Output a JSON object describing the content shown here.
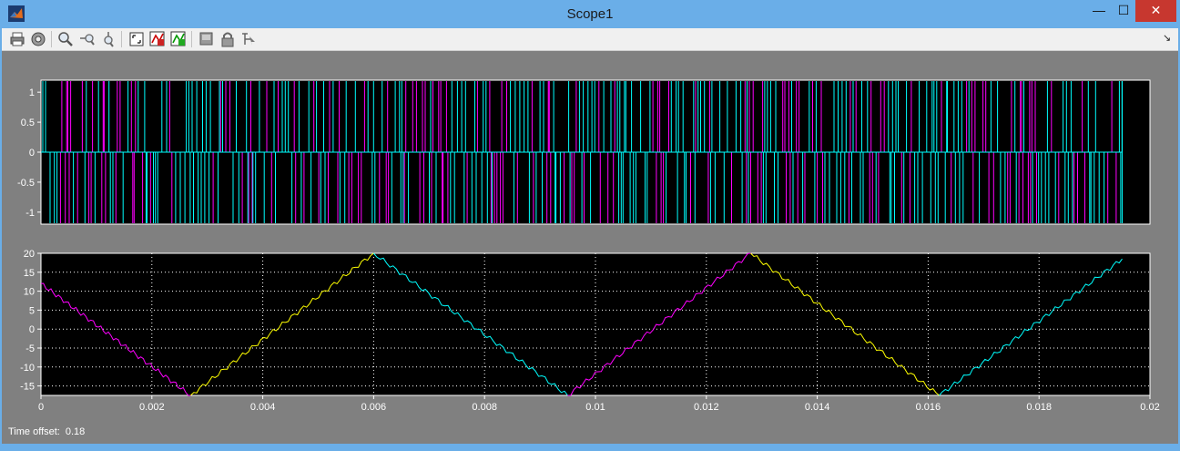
{
  "window": {
    "title": "Scope1",
    "controls": {
      "minimize": "—",
      "maximize": "☐",
      "close": "✕"
    }
  },
  "toolbar": {
    "buttons": [
      {
        "name": "print-icon"
      },
      {
        "name": "parameters-icon"
      },
      {
        "name": "zoom-icon"
      },
      {
        "name": "zoom-x-icon"
      },
      {
        "name": "zoom-y-icon"
      },
      {
        "name": "autoscale-icon"
      },
      {
        "name": "save-axes-settings-icon"
      },
      {
        "name": "restore-axes-settings-icon"
      },
      {
        "name": "floating-scope-icon"
      },
      {
        "name": "lock-axes-icon"
      },
      {
        "name": "signal-selection-icon"
      }
    ],
    "dock_glyph": "↘"
  },
  "status": {
    "label": "Time offset:",
    "value": "0.18"
  },
  "colors": {
    "plot_bg": "#000000",
    "magenta": "#ff00ff",
    "cyan": "#00ffff",
    "yellow": "#ffff00",
    "grid": "#ffffff"
  },
  "chart_data": [
    {
      "type": "line",
      "title": "",
      "xlim": [
        0,
        0.02
      ],
      "ylim": [
        -1.2,
        1.2
      ],
      "y_ticks": [
        "1",
        "0.5",
        "0",
        "-0.5",
        "-1"
      ],
      "y_tick_values": [
        1,
        0.5,
        0,
        -0.5,
        -1
      ],
      "pulse_x_end": 0.0195,
      "series": [
        {
          "color": "magenta",
          "values_description": "PWM pulses ±1"
        },
        {
          "color": "cyan",
          "values_description": "PWM pulses ±1"
        }
      ]
    },
    {
      "type": "line",
      "title": "",
      "xlim": [
        0,
        0.02
      ],
      "ylim": [
        -17.5,
        20
      ],
      "y_ticks": [
        "20",
        "15",
        "10",
        "5",
        "0",
        "-5",
        "-10",
        "-15"
      ],
      "y_tick_values": [
        20,
        15,
        10,
        5,
        0,
        -5,
        -10,
        -15
      ],
      "x_ticks": [
        "0",
        "0.002",
        "0.004",
        "0.006",
        "0.008",
        "0.01",
        "0.012",
        "0.014",
        "0.016",
        "0.018",
        "0.02"
      ],
      "x_tick_values": [
        0,
        0.002,
        0.004,
        0.006,
        0.008,
        0.01,
        0.012,
        0.014,
        0.016,
        0.018,
        0.02
      ],
      "series": [
        {
          "color": "magenta",
          "x": [
            0,
            0.0027
          ],
          "y": [
            12,
            -17.5
          ]
        },
        {
          "color": "yellow",
          "x": [
            0.0027,
            0.006
          ],
          "y": [
            -17.5,
            20
          ]
        },
        {
          "color": "cyan",
          "x": [
            0.006,
            0.0095
          ],
          "y": [
            20,
            -17.5
          ]
        },
        {
          "color": "magenta",
          "x": [
            0.0095,
            0.0128
          ],
          "y": [
            -17.5,
            20
          ]
        },
        {
          "color": "yellow",
          "x": [
            0.0128,
            0.0162
          ],
          "y": [
            20,
            -17.5
          ]
        },
        {
          "color": "cyan",
          "x": [
            0.0162,
            0.0195
          ],
          "y": [
            -17.5,
            18.5
          ]
        }
      ]
    }
  ]
}
